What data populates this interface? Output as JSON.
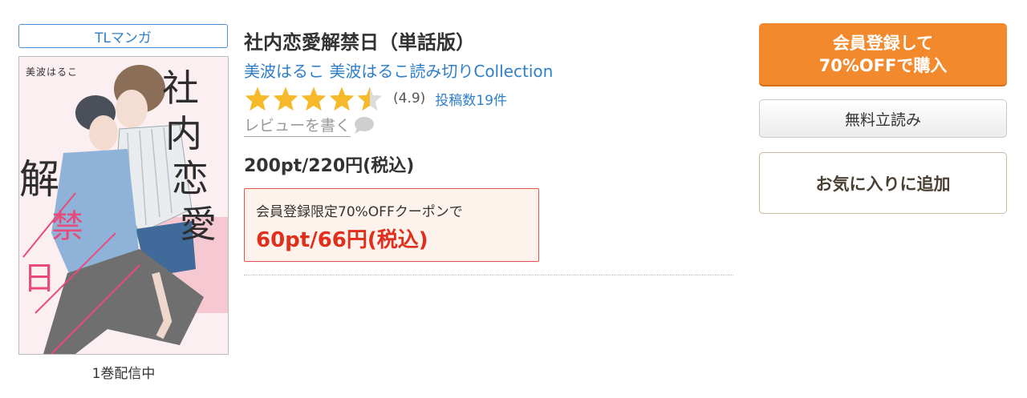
{
  "product": {
    "genre_tag": "TLマンガ",
    "volume_status": "1巻配信中",
    "title": "社内恋愛解禁日（単話版）",
    "author": "美波はるこ",
    "series": "美波はるこ読み切りCollection",
    "rating_value": "(4.9)",
    "rating_stars": 4.5,
    "review_count": "投稿数19件",
    "write_review_label": "レビューを書く",
    "price": "200pt/220円(税込)",
    "coupon": {
      "label": "会員登録限定70%OFFクーポンで",
      "price": "60pt/66円(税込)"
    }
  },
  "cover": {
    "author_text": "美波はるこ"
  },
  "buttons": {
    "buy_line1": "会員登録して",
    "buy_line2": "70%OFFで購入",
    "free_read": "無料立読み",
    "favorite": "お気に入りに追加"
  },
  "icons": {
    "star": "star-icon",
    "speech": "speech-bubble-icon"
  },
  "colors": {
    "link_blue": "#2f7fc8",
    "star_gold": "#f5b92a",
    "coupon_red": "#e02f1d",
    "buy_orange": "#f28a2d"
  }
}
